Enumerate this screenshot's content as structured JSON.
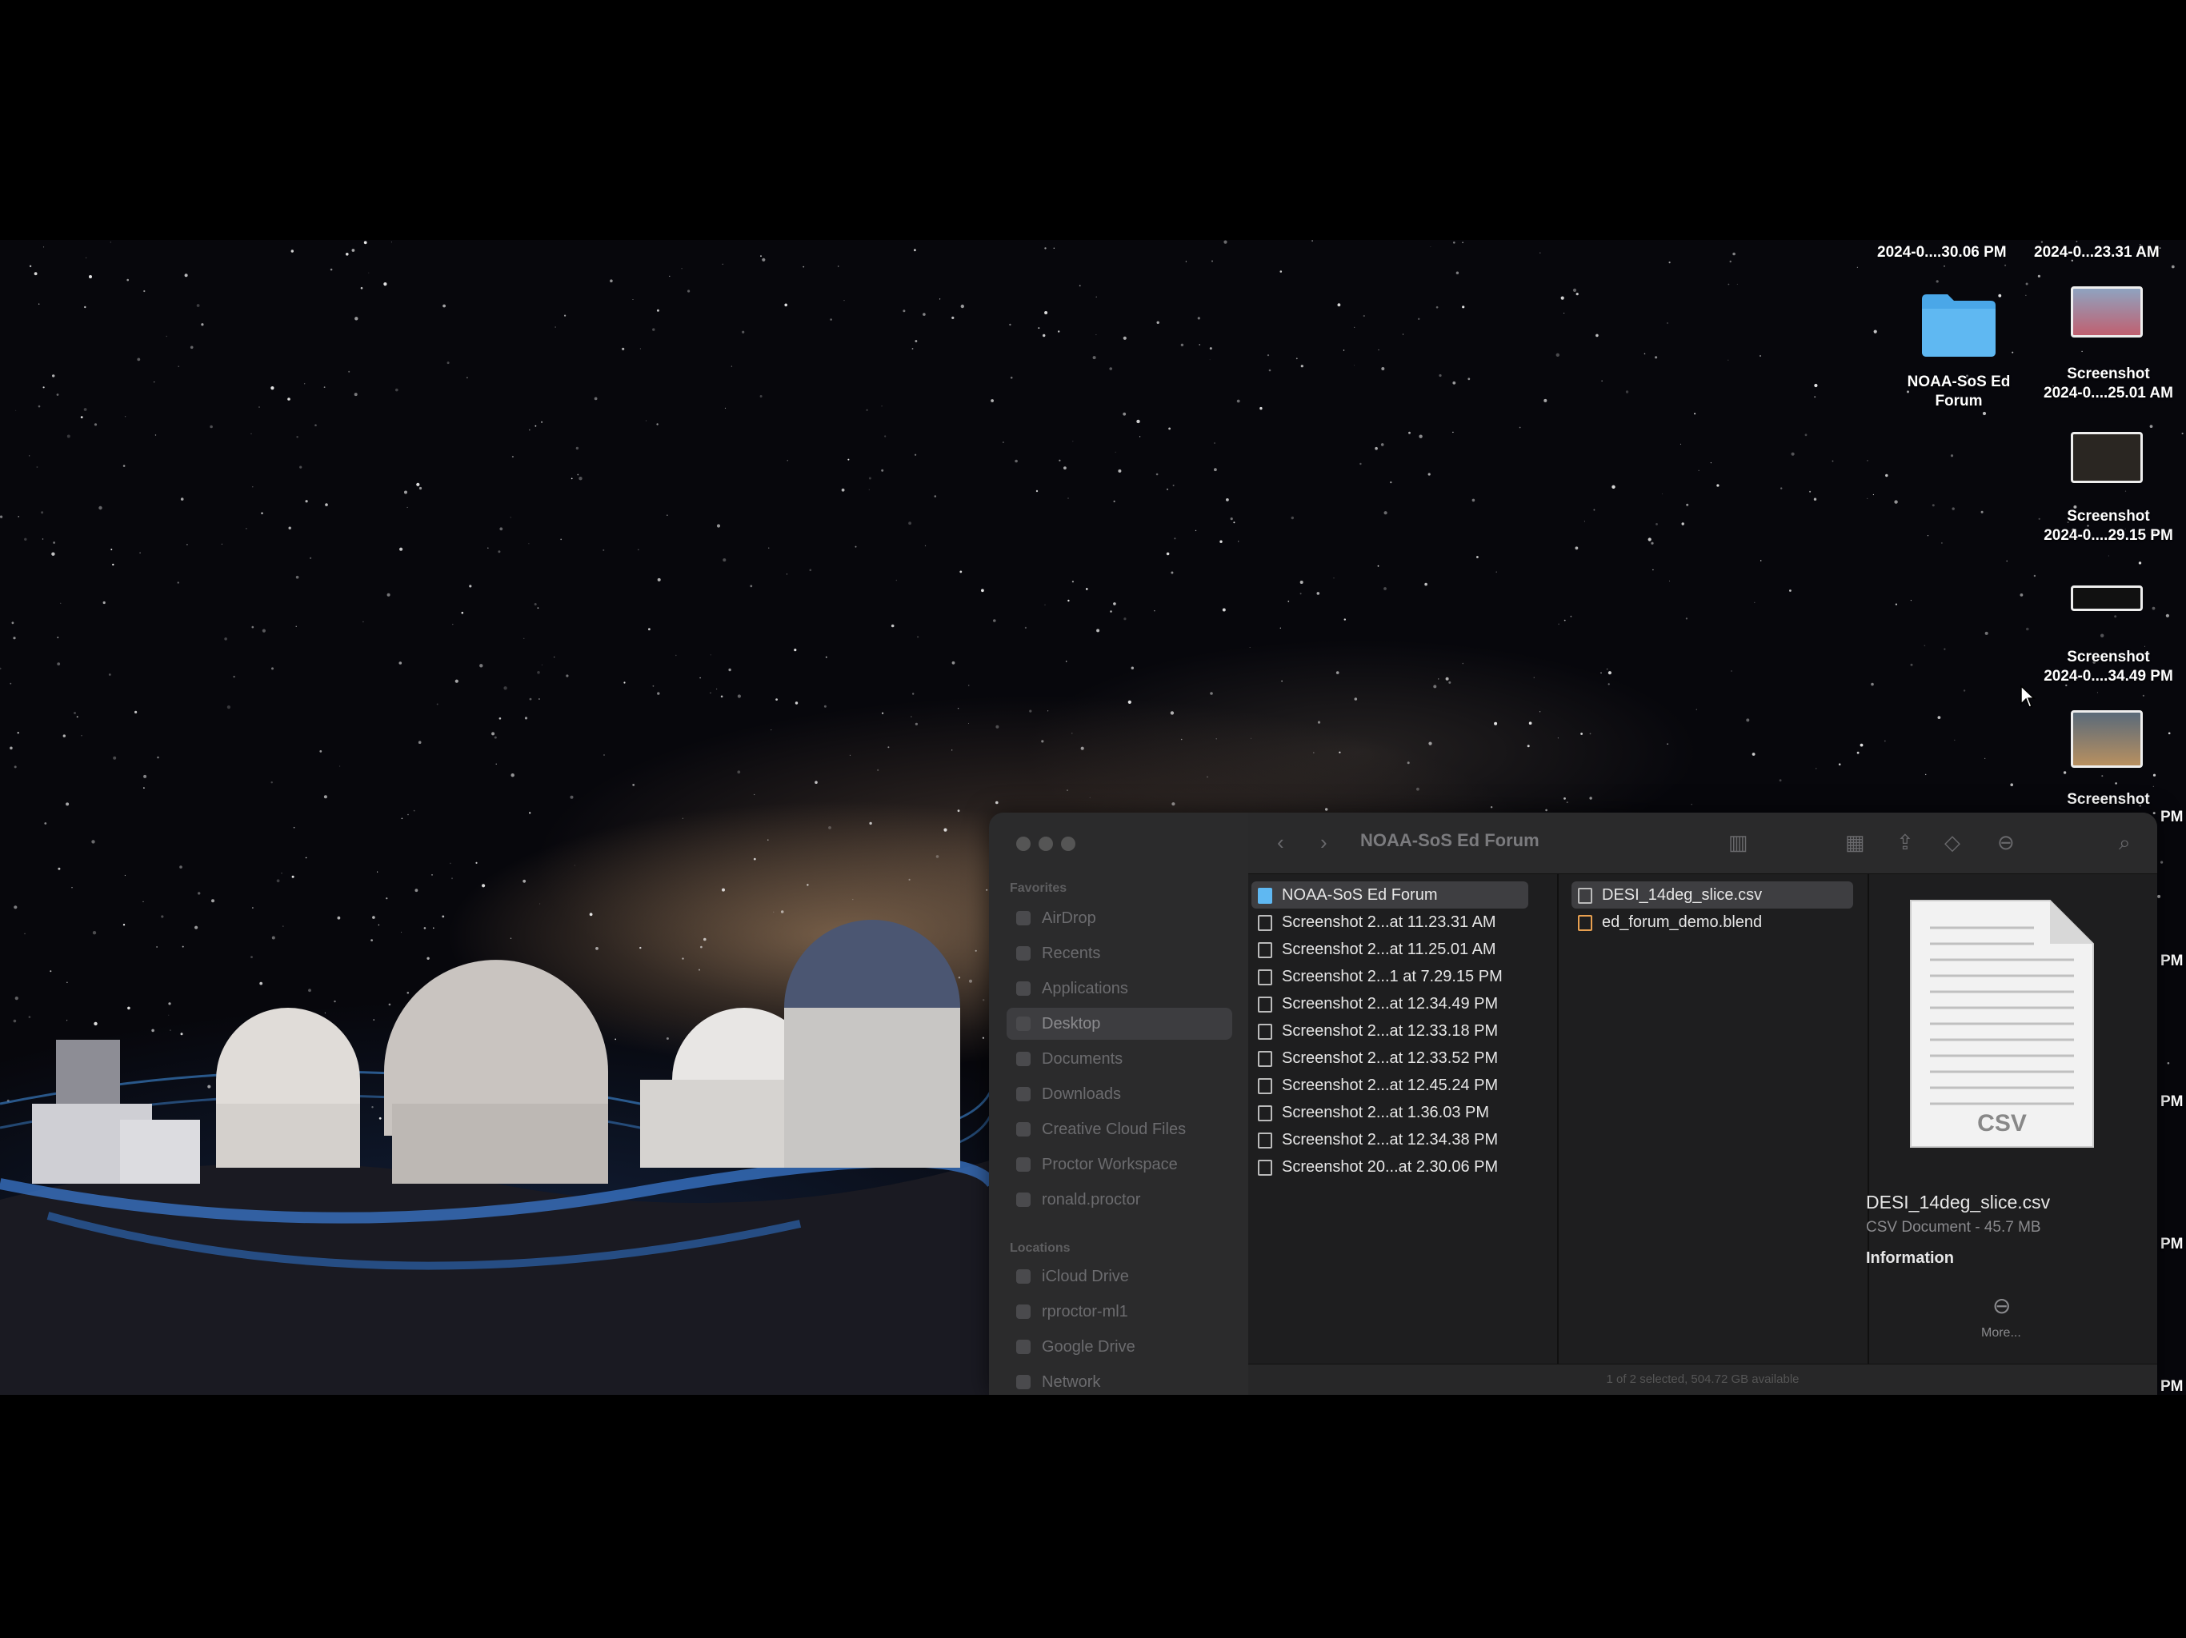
{
  "desktop": {
    "top_labels": [
      "2024-0....30.06 PM",
      "2024-0...23.31 AM"
    ],
    "icons": [
      {
        "name": "NOAA-SoS Ed Forum",
        "line1": "NOAA-SoS Ed",
        "line2": "Forum"
      },
      {
        "line1": "Screenshot",
        "line2": "2024-0....25.01 AM"
      },
      {
        "line1": "Screenshot",
        "line2": "2024-0....29.15 PM"
      },
      {
        "line1": "Screenshot",
        "line2": "2024-0....34.49 PM"
      },
      {
        "line1": "Screenshot",
        "line2": ""
      }
    ],
    "edge_labels": [
      "PM",
      "PM",
      "PM",
      "PM",
      "PM"
    ]
  },
  "finder": {
    "title": "NOAA-SoS Ed Forum",
    "sidebar": {
      "favorites_label": "Favorites",
      "favorites": [
        "AirDrop",
        "Recents",
        "Applications",
        "Desktop",
        "Documents",
        "Downloads",
        "Creative Cloud Files",
        "Proctor Workspace",
        "ronald.proctor"
      ],
      "locations_label": "Locations",
      "locations": [
        "iCloud Drive",
        "rproctor-ml1",
        "Google Drive",
        "Network"
      ]
    },
    "column1": [
      "NOAA-SoS Ed Forum",
      "Screenshot 2...at 11.23.31 AM",
      "Screenshot 2...at 11.25.01 AM",
      "Screenshot 2...1 at 7.29.15 PM",
      "Screenshot 2...at 12.34.49 PM",
      "Screenshot 2...at 12.33.18 PM",
      "Screenshot 2...at 12.33.52 PM",
      "Screenshot 2...at 12.45.24 PM",
      "Screenshot 2...at 1.36.03 PM",
      "Screenshot 2...at 12.34.38 PM",
      "Screenshot 20...at 2.30.06 PM"
    ],
    "column2": [
      "DESI_14deg_slice.csv",
      "ed_forum_demo.blend"
    ],
    "preview": {
      "badge": "CSV",
      "name": "DESI_14deg_slice.csv",
      "kind": "CSV Document - 45.7 MB",
      "info": "Information",
      "more": "More..."
    },
    "status": "1 of 2 selected, 504.72 GB available"
  }
}
